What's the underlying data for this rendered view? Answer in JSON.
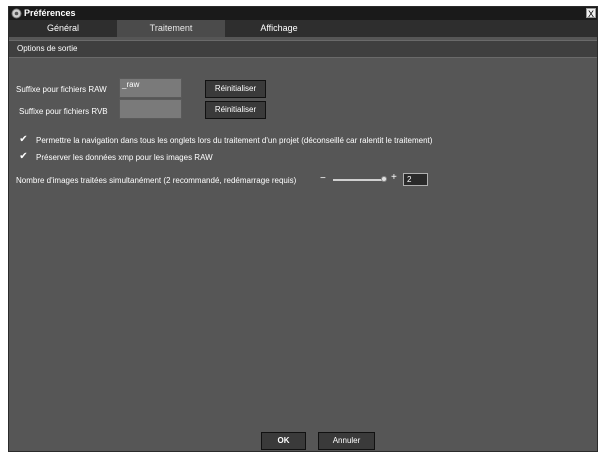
{
  "window": {
    "title": "Préférences",
    "close_glyph": "X"
  },
  "tabs": [
    {
      "label": "Général",
      "active": false
    },
    {
      "label": "Traitement",
      "active": true
    },
    {
      "label": "Affichage",
      "active": false
    }
  ],
  "section": {
    "title": "Options de sortie"
  },
  "fields": {
    "raw_suffix": {
      "label": "Suffixe pour fichiers RAW",
      "value": "_raw",
      "reset_label": "Réinitialiser"
    },
    "rvb_suffix": {
      "label": "Suffixe pour fichiers RVB",
      "value": "",
      "reset_label": "Réinitialiser"
    }
  },
  "options": {
    "navigation": {
      "checked": true,
      "label": "Permettre la navigation dans tous les onglets lors du traitement d'un projet (déconseillé car ralentit le traitement)"
    },
    "xmp": {
      "checked": true,
      "label": "Préserver les données xmp pour les images RAW"
    }
  },
  "concurrency": {
    "label": "Nombre d'images traitées simultanément (2 recommandé, redémarrage requis)",
    "minus": "−",
    "plus": "+",
    "value": "2"
  },
  "footer": {
    "ok_label": "OK",
    "cancel_label": "Annuler"
  },
  "colors": {
    "panel": "#565656",
    "titlebar": "#1a1a1a",
    "tabbar": "#2e2e2e",
    "active_tab": "#4b4b4b"
  }
}
